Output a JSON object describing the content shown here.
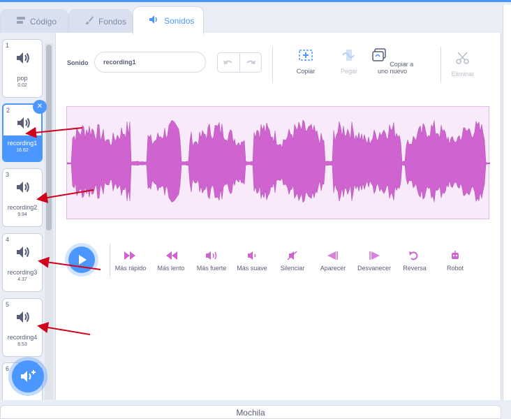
{
  "tabs": [
    {
      "label": "Código",
      "icon": "code-icon"
    },
    {
      "label": "Fondos",
      "icon": "brush-icon"
    },
    {
      "label": "Sonidos",
      "icon": "sound-icon"
    }
  ],
  "sounds": [
    {
      "num": "1",
      "name": "pop",
      "duration": "0.02"
    },
    {
      "num": "2",
      "name": "recording1",
      "duration": "16.62"
    },
    {
      "num": "3",
      "name": "recording2",
      "duration": "9.94"
    },
    {
      "num": "4",
      "name": "recording3",
      "duration": "4.37"
    },
    {
      "num": "5",
      "name": "recording4",
      "duration": "6.53"
    },
    {
      "num": "6",
      "name": "",
      "duration": ""
    }
  ],
  "selected_sound": 2,
  "editor": {
    "sound_label": "Sonido",
    "sound_name": "recording1",
    "tools": {
      "copy": "Copiar",
      "paste": "Pegar",
      "copy_new": "Copiar a uno nuevo",
      "delete": "Eliminar"
    }
  },
  "effects": [
    {
      "label": "Más rápido",
      "icon": "faster-icon"
    },
    {
      "label": "Más lento",
      "icon": "slower-icon"
    },
    {
      "label": "Más fuerte",
      "icon": "louder-icon"
    },
    {
      "label": "Más suave",
      "icon": "softer-icon"
    },
    {
      "label": "Silenciar",
      "icon": "mute-icon"
    },
    {
      "label": "Aparecer",
      "icon": "fade-in-icon"
    },
    {
      "label": "Desvanecer",
      "icon": "fade-out-icon"
    },
    {
      "label": "Reversa",
      "icon": "reverse-icon"
    },
    {
      "label": "Robot",
      "icon": "robot-icon"
    }
  ],
  "backpack_label": "Mochila",
  "colors": {
    "accent": "#4c97ff",
    "wave_fill": "#cf63cf",
    "wave_bg": "#f8e9fb",
    "annotation_arrow": "#d0021b"
  }
}
